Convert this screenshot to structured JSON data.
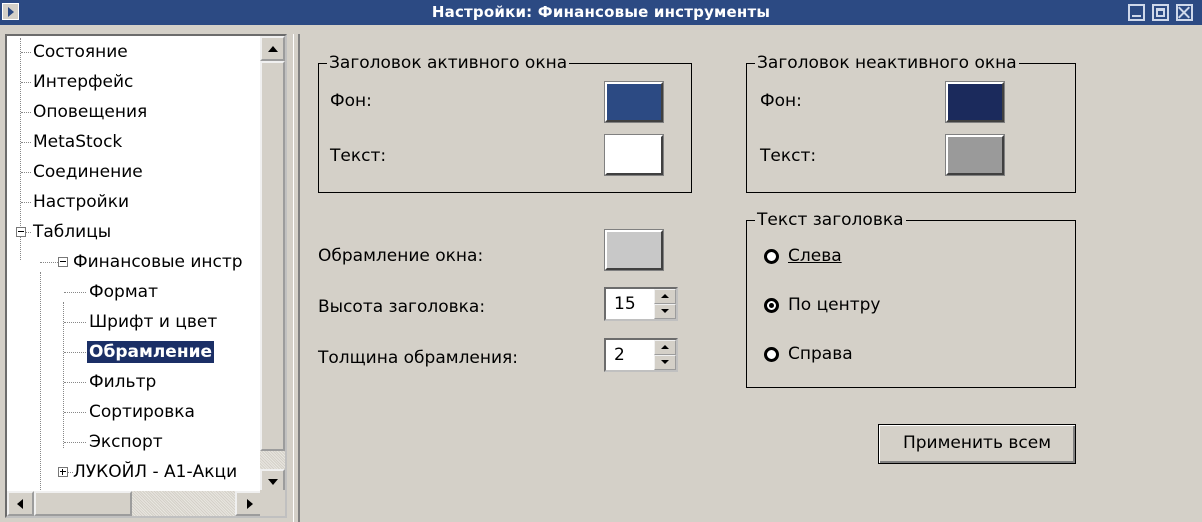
{
  "window": {
    "title": "Настройки: Финансовые инструменты"
  },
  "tree": {
    "items": [
      {
        "label": "Состояние"
      },
      {
        "label": "Интерфейс"
      },
      {
        "label": "Оповещения"
      },
      {
        "label": "MetaStock"
      },
      {
        "label": "Соединение"
      },
      {
        "label": "Настройки"
      },
      {
        "label": "Таблицы",
        "expanded": true
      },
      {
        "label": "Финансовые инстр",
        "expanded": true
      },
      {
        "label": "Формат"
      },
      {
        "label": "Шрифт и цвет"
      },
      {
        "label": "Обрамление",
        "selected": true
      },
      {
        "label": "Фильтр"
      },
      {
        "label": "Сортировка"
      },
      {
        "label": "Экспорт"
      },
      {
        "label": "ЛУКОЙЛ - A1-Акци",
        "expanded": false
      }
    ]
  },
  "active_title": {
    "legend": "Заголовок активного окна",
    "bg_label": "Фон:",
    "bg_color": "#2c4a83",
    "text_label": "Текст:",
    "text_color": "#ffffff"
  },
  "inactive_title": {
    "legend": "Заголовок неактивного окна",
    "bg_label": "Фон:",
    "bg_color": "#1b2a5c",
    "text_label": "Текст:",
    "text_color": "#9a9a9a"
  },
  "frame": {
    "label": "Обрамление окна:",
    "color": "#c8c8c8"
  },
  "title_height": {
    "label": "Высота заголовка:",
    "value": "15"
  },
  "frame_thickness": {
    "label": "Толщина обрамления:",
    "value": "2"
  },
  "title_text": {
    "legend": "Текст заголовка",
    "left_label": "Слева",
    "center_label": "По центру",
    "right_label": "Справа",
    "selected": "center"
  },
  "apply_all_label": "Применить всем"
}
